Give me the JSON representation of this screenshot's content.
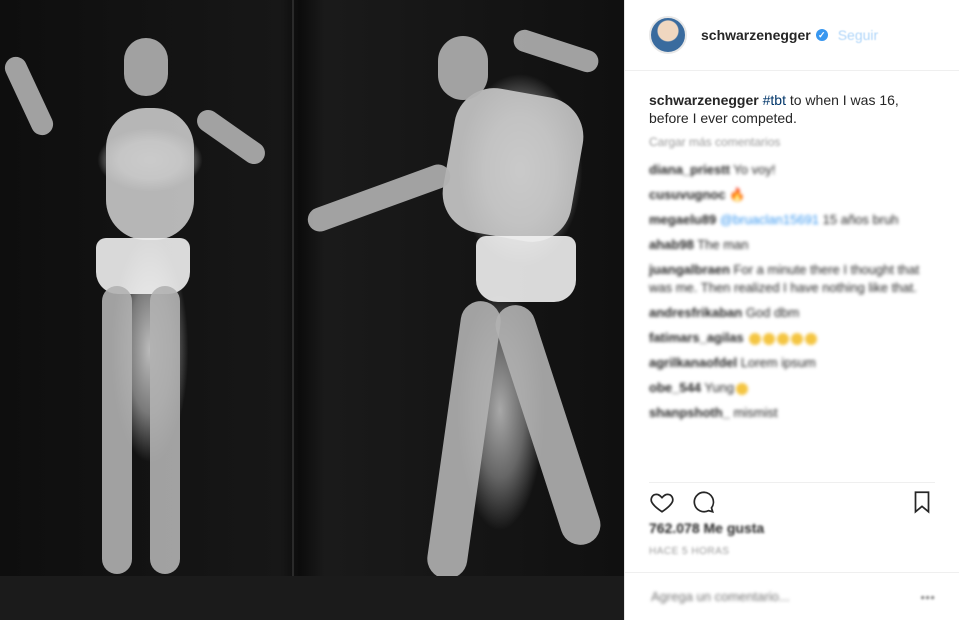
{
  "post": {
    "username": "schwarzenegger",
    "follow_label": "Seguir",
    "caption_user": "schwarzenegger",
    "caption_tag": "#tbt",
    "caption_text": " to when I was 16, before I ever competed.",
    "view_all_comments": "Cargar más comentarios",
    "likes": "762.078 Me gusta",
    "timestamp": "HACE 5 HORAS",
    "add_comment_placeholder": "Agrega un comentario..."
  },
  "comments": [
    {
      "user": "diana_priestt",
      "text": " Yo voy!"
    },
    {
      "user": "cusuvugnoc",
      "text": " 🔥"
    },
    {
      "user": "megaelu89",
      "mention": " @bruaclan15691",
      "text": " 15 años bruh"
    },
    {
      "user": "ahab98",
      "text": " The man"
    },
    {
      "user": "juangalbraen",
      "text": " For a minute there I thought that was me. Then realized I have nothing like that."
    },
    {
      "user": "andresfrikaban",
      "text": " God dbm"
    },
    {
      "user": "fatimars_agilas",
      "text": " "
    },
    {
      "user": "agrilkanaofdel",
      "text": " Lorem ipsum"
    },
    {
      "user": "obe_544",
      "text": " Yung"
    },
    {
      "user": "shanpshoth_",
      "text": " mismist"
    }
  ],
  "icons": {
    "heart": "heart-icon",
    "comment": "comment-icon",
    "bookmark": "bookmark-icon",
    "verified": "verified-icon",
    "more": "more-icon"
  },
  "colors": {
    "link_blue": "#3897f0",
    "text": "#262626",
    "muted": "#999999"
  }
}
